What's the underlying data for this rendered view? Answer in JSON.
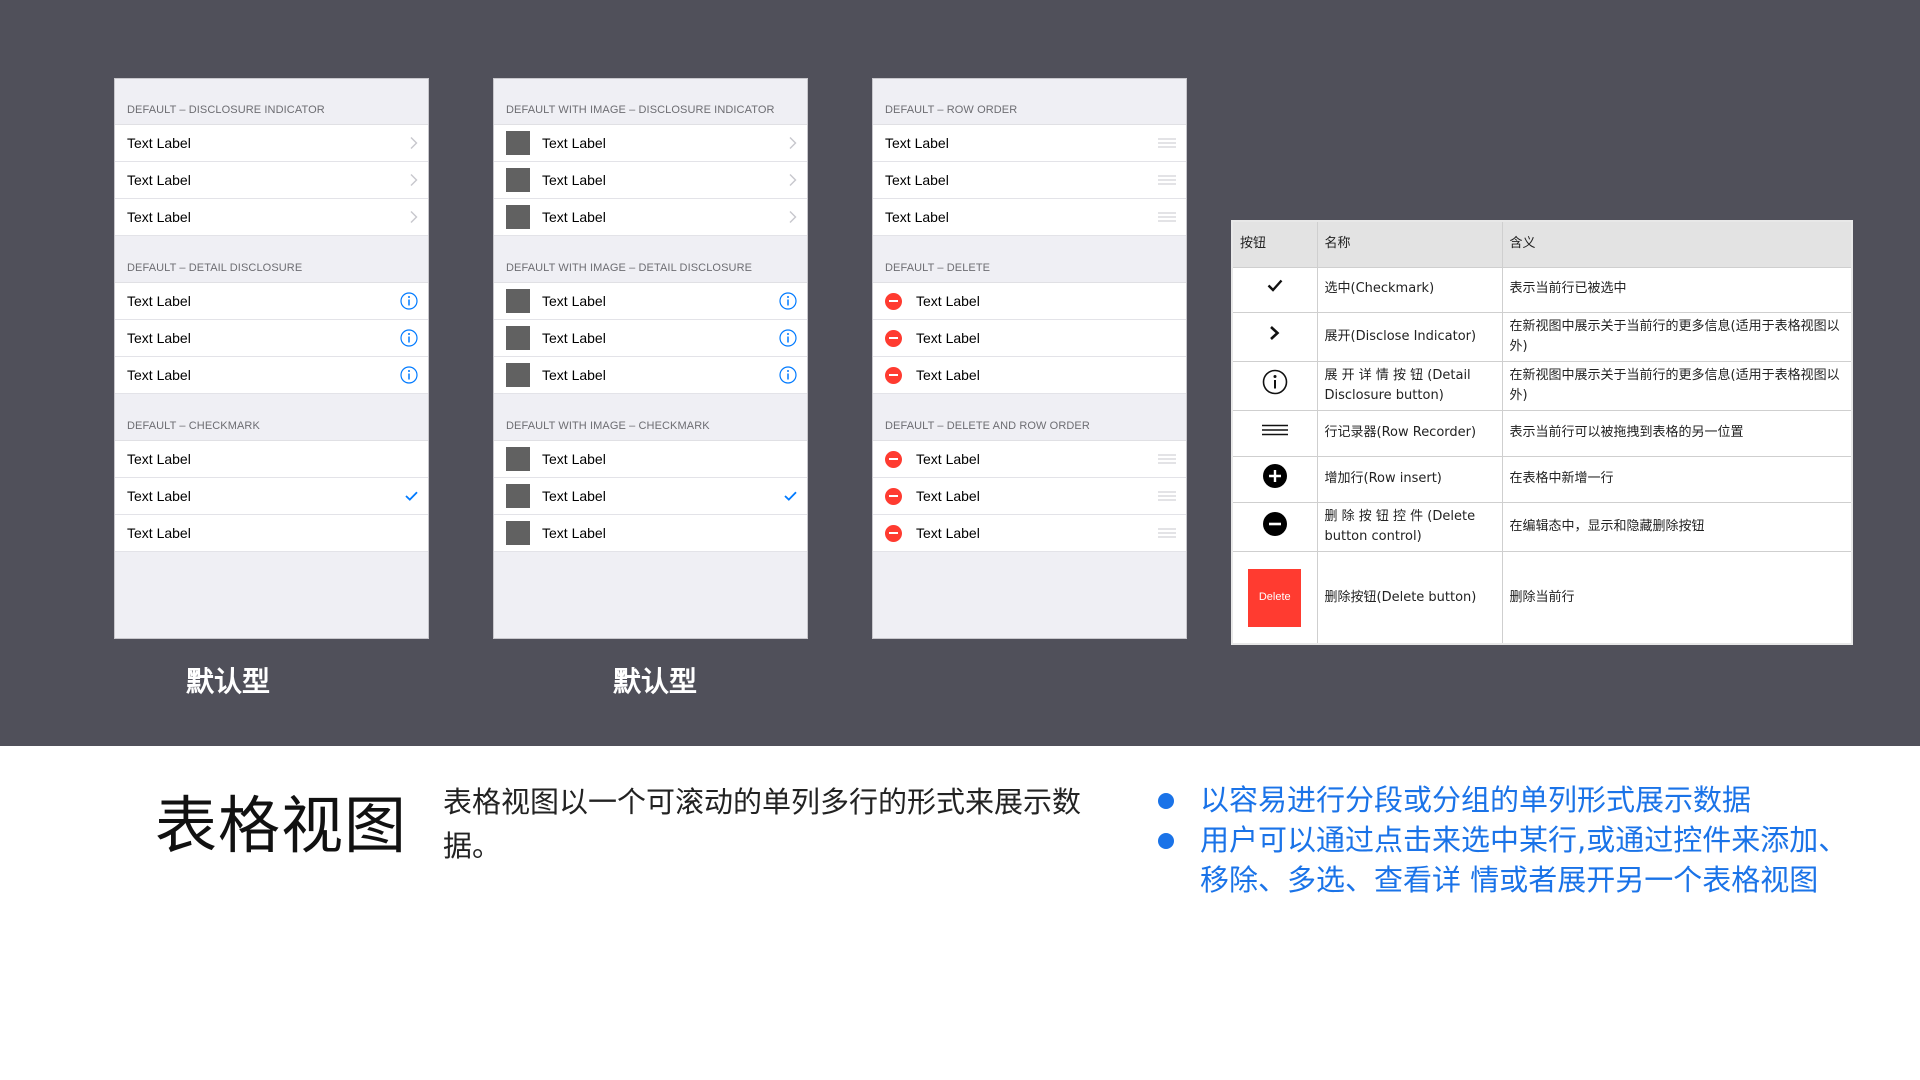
{
  "colors": {
    "band": "#50505a",
    "ios_blue": "#007aff",
    "ios_red": "#ff3b30",
    "bullet_blue": "#1a73e8"
  },
  "panels": [
    {
      "sections": [
        {
          "header": "DEFAULT – DISCLOSURE INDICATOR",
          "rows": [
            {
              "label": "Text Label",
              "accessory": "chevron-right-icon"
            },
            {
              "label": "Text Label",
              "accessory": "chevron-right-icon"
            },
            {
              "label": "Text Label",
              "accessory": "chevron-right-icon"
            }
          ]
        },
        {
          "header": "DEFAULT – DETAIL DISCLOSURE",
          "rows": [
            {
              "label": "Text Label",
              "accessory": "info-icon"
            },
            {
              "label": "Text Label",
              "accessory": "info-icon"
            },
            {
              "label": "Text Label",
              "accessory": "info-icon"
            }
          ]
        },
        {
          "header": "DEFAULT – CHECKMARK",
          "rows": [
            {
              "label": "Text Label",
              "accessory": ""
            },
            {
              "label": "Text Label",
              "accessory": "checkmark-icon"
            },
            {
              "label": "Text Label",
              "accessory": ""
            }
          ]
        }
      ]
    },
    {
      "sections": [
        {
          "header": "DEFAULT WITH IMAGE – DISCLOSURE INDICATOR",
          "rows": [
            {
              "label": "Text Label",
              "accessory": "chevron-right-icon",
              "image": true
            },
            {
              "label": "Text Label",
              "accessory": "chevron-right-icon",
              "image": true
            },
            {
              "label": "Text Label",
              "accessory": "chevron-right-icon",
              "image": true
            }
          ]
        },
        {
          "header": "DEFAULT WITH IMAGE – DETAIL DISCLOSURE",
          "rows": [
            {
              "label": "Text Label",
              "accessory": "info-icon",
              "image": true
            },
            {
              "label": "Text Label",
              "accessory": "info-icon",
              "image": true
            },
            {
              "label": "Text Label",
              "accessory": "info-icon",
              "image": true
            }
          ]
        },
        {
          "header": "DEFAULT WITH IMAGE – CHECKMARK",
          "rows": [
            {
              "label": "Text Label",
              "accessory": "",
              "image": true
            },
            {
              "label": "Text Label",
              "accessory": "checkmark-icon",
              "image": true
            },
            {
              "label": "Text Label",
              "accessory": "",
              "image": true
            }
          ]
        }
      ]
    },
    {
      "sections": [
        {
          "header": "DEFAULT – ROW ORDER",
          "rows": [
            {
              "label": "Text Label",
              "accessory": "reorder-grip-icon"
            },
            {
              "label": "Text Label",
              "accessory": "reorder-grip-icon"
            },
            {
              "label": "Text Label",
              "accessory": "reorder-grip-icon"
            }
          ]
        },
        {
          "header": "DEFAULT – DELETE",
          "rows": [
            {
              "label": "Text Label",
              "accessory": "",
              "delete": true
            },
            {
              "label": "Text Label",
              "accessory": "",
              "delete": true
            },
            {
              "label": "Text Label",
              "accessory": "",
              "delete": true
            }
          ]
        },
        {
          "header": "DEFAULT – DELETE AND ROW ORDER",
          "rows": [
            {
              "label": "Text Label",
              "accessory": "reorder-grip-icon",
              "delete": true
            },
            {
              "label": "Text Label",
              "accessory": "reorder-grip-icon",
              "delete": true
            },
            {
              "label": "Text Label",
              "accessory": "reorder-grip-icon",
              "delete": true
            }
          ]
        }
      ]
    }
  ],
  "captions": [
    "默认型",
    "默认型"
  ],
  "legend_table": {
    "headers": [
      "按钮",
      "名称",
      "含义"
    ],
    "rows": [
      {
        "icon": "checkmark-icon",
        "name": "选中(Checkmark)",
        "meaning": "表示当前行已被选中"
      },
      {
        "icon": "chevron-right-icon",
        "name": "展开(Disclose Indicator)",
        "meaning": "在新视图中展示关于当前行的更多信息(适用于表格视图以外)"
      },
      {
        "icon": "info-icon",
        "name": "展 开 详 情 按 钮 (Detail Disclosure button)",
        "meaning": "在新视图中展示关于当前行的更多信息(适用于表格视图以外)"
      },
      {
        "icon": "reorder-grip-icon",
        "name": "行记录器(Row Recorder)",
        "meaning": "表示当前行可以被拖拽到表格的另一位置"
      },
      {
        "icon": "plus-circle-icon",
        "name": "增加行(Row insert)",
        "meaning": "在表格中新增一行"
      },
      {
        "icon": "minus-circle-icon",
        "name": "删 除 按 钮 控 件 (Delete button control)",
        "meaning": "在编辑态中，显示和隐藏删除按钮"
      },
      {
        "icon": "delete-button-swatch",
        "name": "删除按钮(Delete button)",
        "meaning": "删除当前行",
        "swatch_label": "Delete"
      }
    ]
  },
  "title": "表格视图",
  "description": "表格视图以一个可滚动的单列多行的形式来展示数据。",
  "bullets": [
    "以容易进行分段或分组的单列形式展示数据",
    "用户可以通过点击来选中某行,或通过控件来添加、移除、多选、查看详 情或者展开另一个表格视图"
  ]
}
